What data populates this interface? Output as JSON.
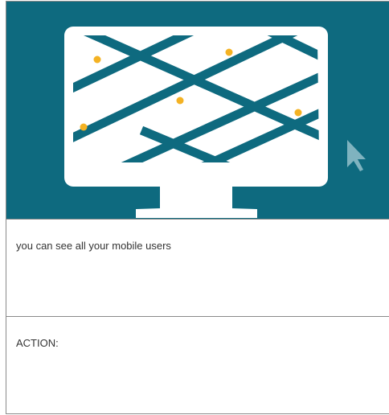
{
  "colors": {
    "hero_background": "#0e6a7f",
    "monitor": "#ffffff",
    "location_dot": "#f4b223",
    "cursor": "#7fb3bf"
  },
  "slide": {
    "illustration": {
      "icons": [
        "desktop-monitor-icon",
        "map-grid-icon",
        "location-dot-icon",
        "mouse-cursor-icon"
      ]
    },
    "caption": "you can see all your mobile users",
    "action_label": "ACTION:"
  }
}
